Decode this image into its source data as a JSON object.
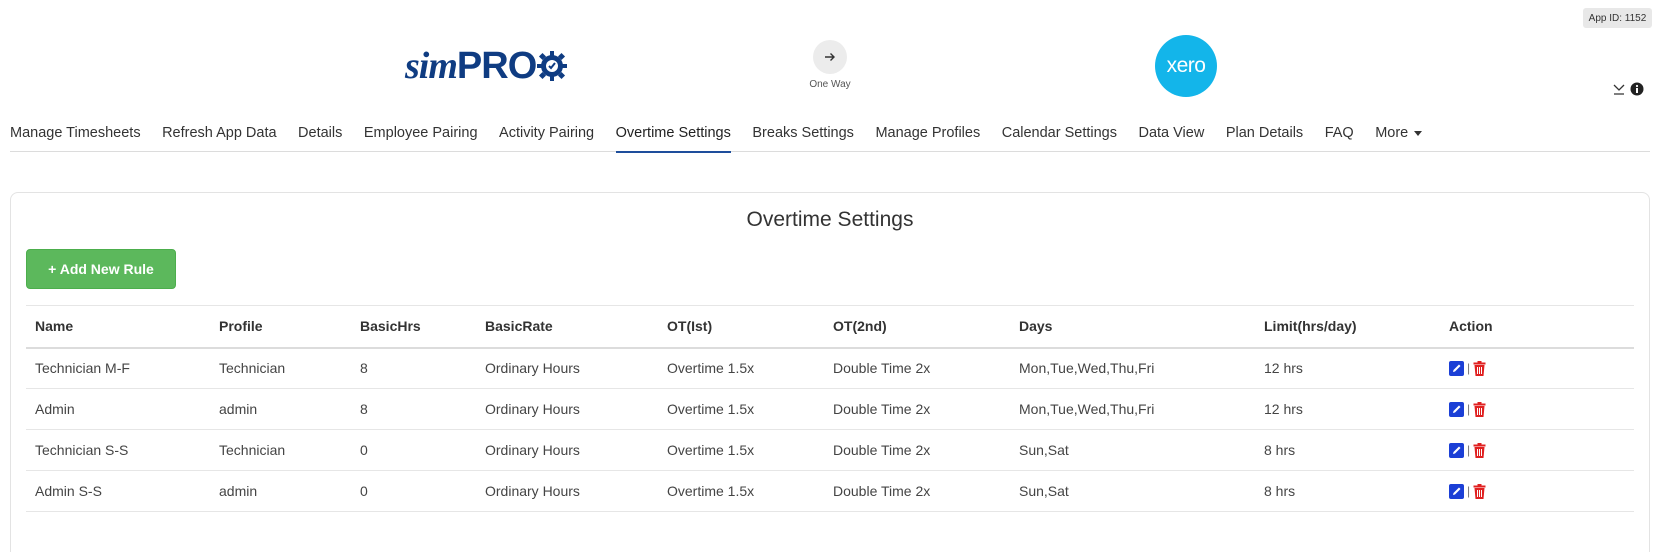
{
  "app_id": "App ID: 1152",
  "brand": {
    "left_logo_sim": "sim",
    "left_logo_pro": "PRO",
    "direction_label": "One Way",
    "right_logo": "xero"
  },
  "tabs": [
    {
      "label": "Manage Timesheets",
      "active": false
    },
    {
      "label": "Refresh App Data",
      "active": false
    },
    {
      "label": "Details",
      "active": false
    },
    {
      "label": "Employee Pairing",
      "active": false
    },
    {
      "label": "Activity Pairing",
      "active": false
    },
    {
      "label": "Overtime Settings",
      "active": true
    },
    {
      "label": "Breaks Settings",
      "active": false
    },
    {
      "label": "Manage Profiles",
      "active": false
    },
    {
      "label": "Calendar Settings",
      "active": false
    },
    {
      "label": "Data View",
      "active": false
    },
    {
      "label": "Plan Details",
      "active": false
    },
    {
      "label": "FAQ",
      "active": false
    },
    {
      "label": "More",
      "active": false,
      "dropdown": true
    }
  ],
  "panel": {
    "title": "Overtime Settings",
    "add_button": "+ Add New Rule"
  },
  "table": {
    "columns": [
      "Name",
      "Profile",
      "BasicHrs",
      "BasicRate",
      "OT(Ist)",
      "OT(2nd)",
      "Days",
      "Limit(hrs/day)",
      "Action"
    ],
    "rows": [
      [
        "Technician M-F",
        "Technician",
        "8",
        "Ordinary Hours",
        "Overtime 1.5x",
        "Double Time 2x",
        "Mon,Tue,Wed,Thu,Fri",
        "12 hrs"
      ],
      [
        "Admin",
        "admin",
        "8",
        "Ordinary Hours",
        "Overtime 1.5x",
        "Double Time 2x",
        "Mon,Tue,Wed,Thu,Fri",
        "12 hrs"
      ],
      [
        "Technician S-S",
        "Technician",
        "0",
        "Ordinary Hours",
        "Overtime 1.5x",
        "Double Time 2x",
        "Sun,Sat",
        "8 hrs"
      ],
      [
        "Admin S-S",
        "admin",
        "0",
        "Ordinary Hours",
        "Overtime 1.5x",
        "Double Time 2x",
        "Sun,Sat",
        "8 hrs"
      ]
    ],
    "action_separator": "|"
  },
  "colors": {
    "simpro_blue": "#0f3c82",
    "xero_blue": "#13b5ea",
    "active_tab_underline": "#1e4e9c",
    "add_button": "#5cb85c",
    "edit_icon": "#1b3fd6",
    "delete_icon": "#e02020"
  },
  "icons": {
    "direction": "arrow-right-icon",
    "top_right": [
      "minimize-icon",
      "info-icon"
    ],
    "row_actions": [
      "edit-icon",
      "trash-icon"
    ]
  }
}
